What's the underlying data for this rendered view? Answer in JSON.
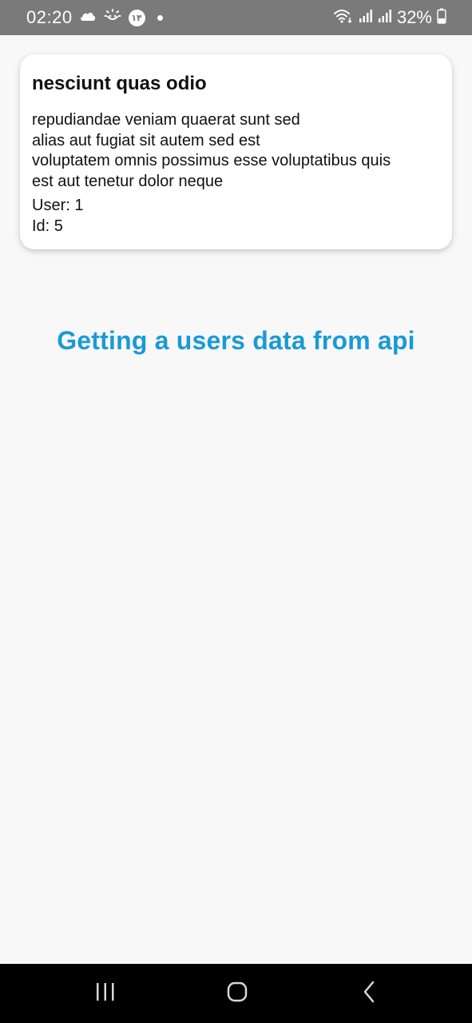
{
  "status_bar": {
    "time": "02:20",
    "badge": "۱۴",
    "battery": "32%",
    "icons": [
      "cloud-icon",
      "sun-icon",
      "notification-badge-icon",
      "dot-icon",
      "wifi-icon",
      "signal-icon",
      "signal-icon",
      "battery-icon"
    ],
    "bg_color": "#7a7a7a"
  },
  "card": {
    "title": "nesciunt quas odio",
    "body": "repudiandae veniam quaerat sunt sed\nalias aut fugiat sit autem sed est\nvoluptatem omnis possimus esse voluptatibus quis\nest aut tenetur dolor neque",
    "user": "User: 1",
    "id": "Id: 5"
  },
  "heading": {
    "text": "Getting a users data from api",
    "color": "#1a9ad6"
  },
  "nav_bar": {
    "buttons": [
      "recent-apps-icon",
      "home-icon",
      "back-icon"
    ]
  }
}
